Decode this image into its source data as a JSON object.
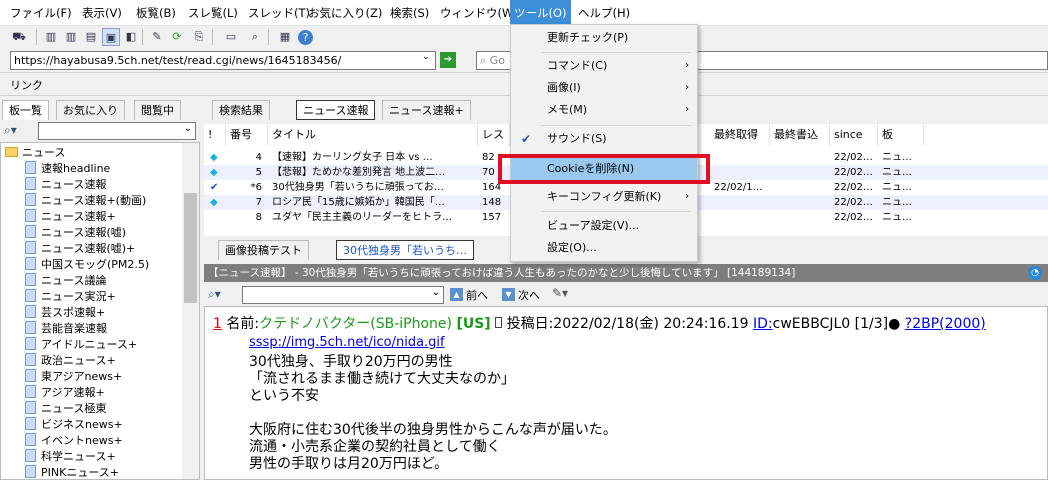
{
  "menubar": {
    "items": [
      "ファイル(F)",
      "表示(V)",
      "板覧(B)",
      "スレ覧(L)",
      "スレッド(T)",
      "お気に入り(Z)",
      "検索(S)",
      "ウィンドウ(W)",
      "ツール(O)",
      "ヘルプ(H)"
    ]
  },
  "address": {
    "url": "https://hayabusa9.5ch.net/test/read.cgi/news/1645183456/",
    "search_placeholder": "Go"
  },
  "link_bar": {
    "label": "リンク"
  },
  "left_tabs": [
    "板一覧",
    "お気に入り",
    "閲覧中"
  ],
  "tree": {
    "root": "ニュース",
    "boards": [
      "速報headline",
      "ニュース速報",
      "ニュース速報+(動画)",
      "ニュース速報+",
      "ニュース速報(嘘)",
      "ニュース速報(嘘)+",
      "中国スモッグ(PM2.5)",
      "ニュース議論",
      "ニュース実況+",
      "芸スポ速報+",
      "芸能音楽速報",
      "アイドルニュース+",
      "政治ニュース+",
      "東アジアnews+",
      "アジア速報+",
      "ニュース極東",
      "ビジネスnews+",
      "イベントnews+",
      "科学ニュース+",
      "PINKニュース+"
    ]
  },
  "list_tabs": [
    "検索結果",
    "ニュース速報",
    "ニュース速報+"
  ],
  "list_headers": [
    "!",
    "番号",
    "タイトル",
    "レス",
    "最終取得",
    "最終書込",
    "since",
    "板"
  ],
  "threads": [
    {
      "mark": "◆",
      "num": "4",
      "title": "【速報】カーリング女子 日本 vs …",
      "res": "82",
      "got": "",
      "since": "22/02…",
      "board": "ニュ…"
    },
    {
      "mark": "◆",
      "num": "5",
      "title": "【悲報】ためかな差別発言 地上波二…",
      "res": "70",
      "got": "",
      "since": "22/02…",
      "board": "ニュ…"
    },
    {
      "mark": "✔",
      "num": "*6",
      "title": "30代独身男「若いうちに頑張ってお…",
      "res": "164",
      "got": "22/02/1…",
      "since": "22/02…",
      "board": "ニュ…"
    },
    {
      "mark": "◆",
      "num": "7",
      "title": "ロシア民「15歳に嫉妬か」韓国民「…",
      "res": "148",
      "got": "",
      "since": "22/02…",
      "board": "ニュ…"
    },
    {
      "mark": "",
      "num": "8",
      "title": "ユダヤ「民主主義のリーダーをヒトラ…",
      "res": "157",
      "got": "",
      "since": "22/02…",
      "board": "ニュ…"
    }
  ],
  "thread_tabs": [
    "画像投稿テスト",
    "30代独身男「若いうち…"
  ],
  "thread_title": "【ニュース速報】 - 30代独身男「若いうちに頑張っておけば違う人生もあったのかなと少し後悔しています」 [144189134]",
  "findbar": {
    "prev": "前へ",
    "next": "次へ"
  },
  "post": {
    "num": "1",
    "name_label": "名前:",
    "name": "クテドノバクター(SB-iPhone)",
    "country": "[US]",
    "date": "投稿日:2022/02/18(金) 20:24:16.19",
    "id_label": "ID:",
    "id": "cwEBBCJL0 [1/3]●",
    "be": "?2BP(2000)",
    "img": "sssp://img.5ch.net/ico/nida.gif",
    "lines": [
      "30代独身、手取り20万円の男性",
      "「流されるまま働き続けて大丈夫なのか」",
      "という不安",
      "",
      "大阪府に住む30代後半の独身男性からこんな声が届いた。",
      "流通・小売系企業の契約社員として働く",
      "男性の手取りは月20万円ほど。"
    ]
  },
  "tools_menu": {
    "items": [
      {
        "label": "更新チェック(P)",
        "sub": false,
        "check": false
      },
      {
        "label": "コマンド(C)",
        "sub": true,
        "check": false
      },
      {
        "label": "画像(I)",
        "sub": true,
        "check": false
      },
      {
        "label": "メモ(M)",
        "sub": true,
        "check": false
      },
      {
        "label": "サウンド(S)",
        "sub": false,
        "check": true
      },
      {
        "label": "Cookieを削除(N)",
        "sub": false,
        "check": false
      },
      {
        "label": "キーコンフィグ更新(K)",
        "sub": true,
        "check": false
      },
      {
        "label": "ビューア設定(V)...",
        "sub": false,
        "check": false
      },
      {
        "label": "設定(O)...",
        "sub": false,
        "check": false
      }
    ]
  },
  "colors": {
    "menu_highlight": "#3c8fd8",
    "item_highlight": "#9ac9f0",
    "redbox": "#e01024",
    "link": "#0000ee",
    "name_green": "#1a9a1a"
  }
}
